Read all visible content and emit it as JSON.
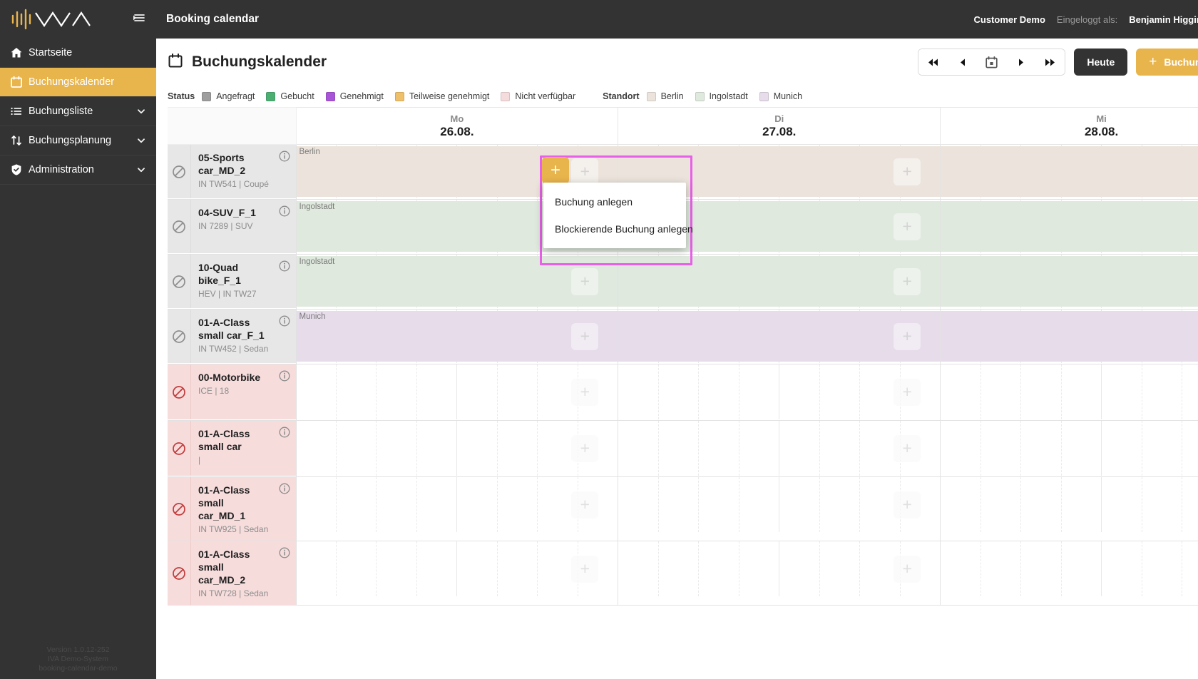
{
  "sidebar": {
    "logo_name": "iva-logo",
    "collapse_icon": "collapse-sidebar-icon",
    "items": [
      {
        "label": "Startseite",
        "icon": "home-icon",
        "active": false,
        "expandable": false
      },
      {
        "label": "Buchungskalender",
        "icon": "calendar-icon",
        "active": true,
        "expandable": false
      },
      {
        "label": "Buchungsliste",
        "icon": "list-icon",
        "active": false,
        "expandable": true
      },
      {
        "label": "Buchungsplanung",
        "icon": "swap-arrows-icon",
        "active": false,
        "expandable": true
      },
      {
        "label": "Administration",
        "icon": "shield-check-icon",
        "active": false,
        "expandable": true
      }
    ],
    "footer": {
      "version": "Version 1.0.12-252",
      "system": "IVA Demo-System",
      "instance": "booking-calendar-demo"
    }
  },
  "topbar": {
    "title": "Booking calendar",
    "customer": "Customer Demo",
    "logged_in_label": "Eingeloggt als:",
    "user_name": "Benjamin Higgins",
    "logout_icon": "logout-icon",
    "language_icon": "globe-icon"
  },
  "toolbar": {
    "page_icon": "calendar-icon",
    "page_title": "Buchungskalender",
    "nav": [
      {
        "name": "prev-fast",
        "glyph": "◀◀"
      },
      {
        "name": "prev",
        "glyph": "◀"
      },
      {
        "name": "date-picker",
        "glyph": "calendar-icon"
      },
      {
        "name": "next",
        "glyph": "▶"
      },
      {
        "name": "next-fast",
        "glyph": "▶▶"
      }
    ],
    "today_label": "Heute",
    "booking_label": "Buchung",
    "booking_plus": "+",
    "refresh_icon": "refresh-icon"
  },
  "legend": {
    "status_label": "Status",
    "status_items": [
      {
        "label": "Angefragt",
        "color": "#9e9e9e"
      },
      {
        "label": "Gebucht",
        "color": "#4caf72"
      },
      {
        "label": "Genehmigt",
        "color": "#a855d8"
      },
      {
        "label": "Teilweise genehmigt",
        "color": "#eec06a"
      },
      {
        "label": "Nicht verfügbar",
        "color": "#f5dcdc"
      }
    ],
    "location_label": "Standort",
    "location_items": [
      {
        "label": "Berlin",
        "color": "#ece4dc"
      },
      {
        "label": "Ingolstadt",
        "color": "#dfe9dd"
      },
      {
        "label": "Munich",
        "color": "#e6dcea"
      }
    ]
  },
  "calendar": {
    "days": [
      {
        "dow": "Mo",
        "date": "26.08."
      },
      {
        "dow": "Di",
        "date": "27.08."
      },
      {
        "dow": "Mi",
        "date": "28.08."
      }
    ],
    "rows": [
      {
        "name": "05-Sports car_MD_2",
        "sub": "IN TW541 | Coupé",
        "state": "available",
        "location": "Berlin",
        "band_color": "#ece4dc",
        "banded": true
      },
      {
        "name": "04-SUV_F_1",
        "sub": "IN 7289 | SUV",
        "state": "available",
        "location": "Ingolstadt",
        "band_color": "#dfe9dd",
        "banded": true
      },
      {
        "name": "10-Quad bike_F_1",
        "sub": "HEV | IN TW27",
        "state": "available",
        "location": "Ingolstadt",
        "band_color": "#dfe9dd",
        "banded": true
      },
      {
        "name": "01-A-Class small car_F_1",
        "sub": "IN TW452 | Sedan",
        "state": "available",
        "location": "Munich",
        "band_color": "#e6dcea",
        "banded": true
      },
      {
        "name": "00-Motorbike",
        "sub": "ICE | 18",
        "state": "blocked",
        "location": "",
        "band_color": "",
        "banded": false
      },
      {
        "name": "01-A-Class small car",
        "sub": "|",
        "state": "blocked",
        "location": "",
        "band_color": "",
        "banded": false
      },
      {
        "name": "01-A-Class small car_MD_1",
        "sub": "IN TW925 | Sedan",
        "state": "blocked",
        "location": "",
        "band_color": "",
        "banded": false
      },
      {
        "name": "01-A-Class small car_MD_2",
        "sub": "IN TW728 | Sedan",
        "state": "blocked",
        "location": "",
        "band_color": "",
        "banded": false
      }
    ],
    "block_icon": "no-entry-icon",
    "info_icon": "info-icon",
    "add_glyph": "+"
  },
  "context_menu": {
    "items": [
      "Buchung anlegen",
      "Blockierende Buchung anlegen"
    ],
    "plus_glyph": "+",
    "selection_color": "#e85fe8"
  }
}
